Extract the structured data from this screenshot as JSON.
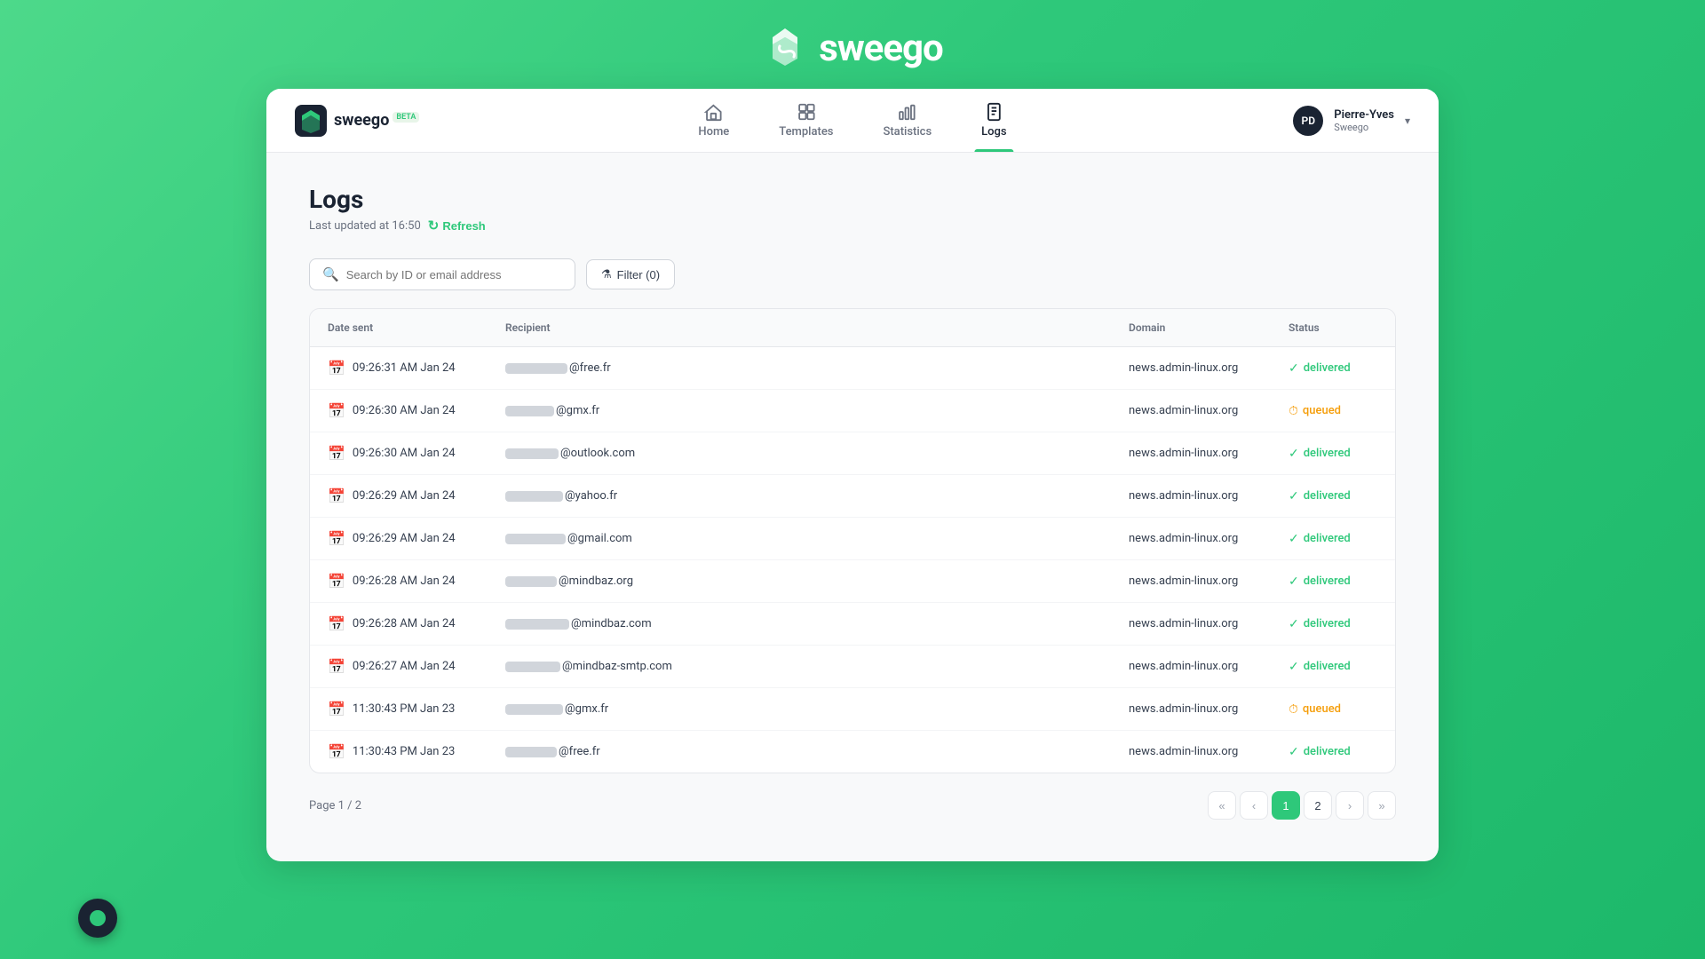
{
  "brand": {
    "name": "sweego",
    "badge": "BETA",
    "top_logo_text": "sweego"
  },
  "nav": {
    "items": [
      {
        "id": "home",
        "label": "Home",
        "active": false
      },
      {
        "id": "templates",
        "label": "Templates",
        "active": false
      },
      {
        "id": "statistics",
        "label": "Statistics",
        "active": false
      },
      {
        "id": "logs",
        "label": "Logs",
        "active": true
      }
    ],
    "user": {
      "initials": "PD",
      "name": "Pierre-Yves",
      "org": "Sweego"
    }
  },
  "page": {
    "title": "Logs",
    "subtitle": "Last updated at 16:50",
    "refresh_label": "Refresh"
  },
  "toolbar": {
    "search_placeholder": "Search by ID or email address",
    "filter_label": "Filter (0)"
  },
  "table": {
    "headers": [
      "Date sent",
      "Recipient",
      "Domain",
      "Status"
    ],
    "rows": [
      {
        "date": "09:26:31 AM Jan 24",
        "recipient_suffix": "@free.fr",
        "blur_width": 70,
        "domain": "news.admin-linux.org",
        "status": "delivered"
      },
      {
        "date": "09:26:30 AM Jan 24",
        "recipient_suffix": "@gmx.fr",
        "blur_width": 55,
        "domain": "news.admin-linux.org",
        "status": "queued"
      },
      {
        "date": "09:26:30 AM Jan 24",
        "recipient_suffix": "@outlook.com",
        "blur_width": 60,
        "domain": "news.admin-linux.org",
        "status": "delivered"
      },
      {
        "date": "09:26:29 AM Jan 24",
        "recipient_suffix": "@yahoo.fr",
        "blur_width": 65,
        "domain": "news.admin-linux.org",
        "status": "delivered"
      },
      {
        "date": "09:26:29 AM Jan 24",
        "recipient_suffix": "@gmail.com",
        "blur_width": 68,
        "domain": "news.admin-linux.org",
        "status": "delivered"
      },
      {
        "date": "09:26:28 AM Jan 24",
        "recipient_suffix": "@mindbaz.org",
        "blur_width": 58,
        "domain": "news.admin-linux.org",
        "status": "delivered"
      },
      {
        "date": "09:26:28 AM Jan 24",
        "recipient_suffix": "@mindbaz.com",
        "blur_width": 72,
        "domain": "news.admin-linux.org",
        "status": "delivered"
      },
      {
        "date": "09:26:27 AM Jan 24",
        "recipient_suffix": "@mindbaz-smtp.com",
        "blur_width": 62,
        "domain": "news.admin-linux.org",
        "status": "delivered"
      },
      {
        "date": "11:30:43 PM Jan 23",
        "recipient_suffix": "@gmx.fr",
        "blur_width": 65,
        "domain": "news.admin-linux.org",
        "status": "queued"
      },
      {
        "date": "11:30:43 PM Jan 23",
        "recipient_suffix": "@free.fr",
        "blur_width": 58,
        "domain": "news.admin-linux.org",
        "status": "delivered"
      }
    ]
  },
  "pagination": {
    "page_info": "Page 1 / 2",
    "current": 1,
    "total": 2,
    "buttons": [
      "«",
      "‹",
      "1",
      "2",
      "›",
      "»"
    ]
  }
}
